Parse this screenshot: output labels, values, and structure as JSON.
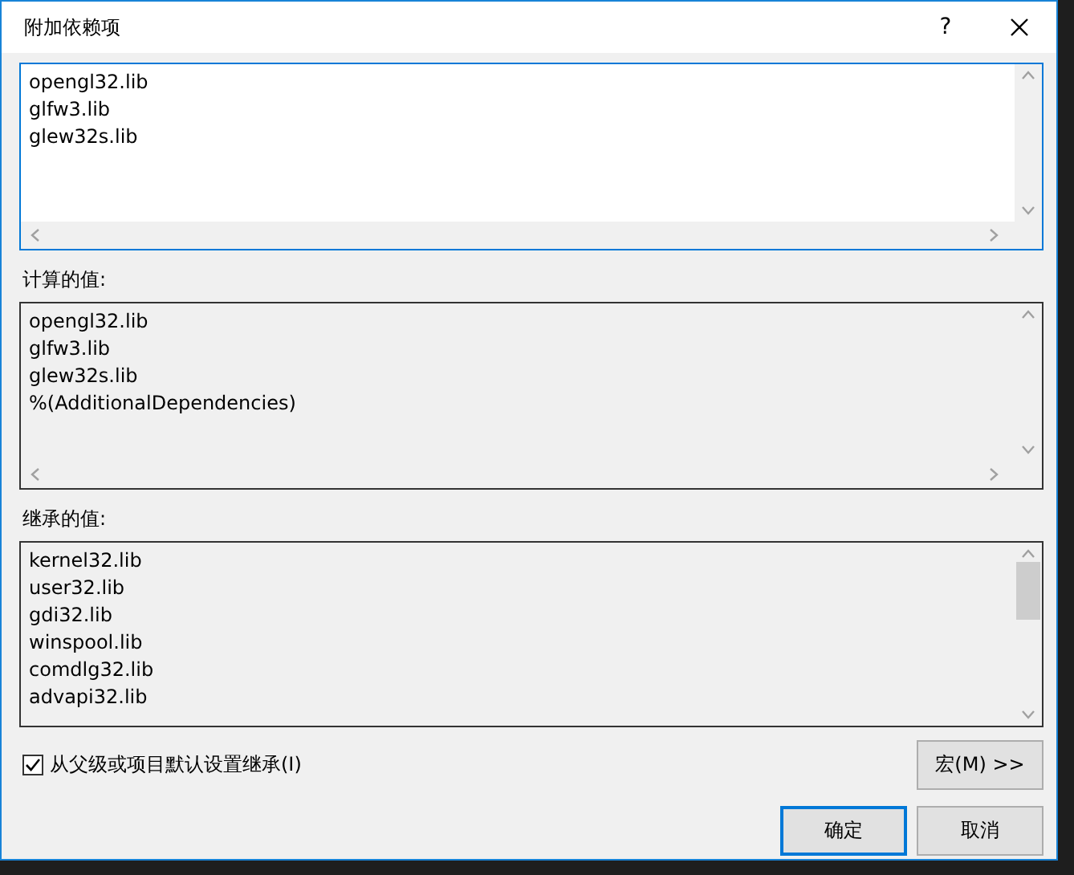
{
  "window": {
    "title": "附加依赖项",
    "help": "?"
  },
  "editor": {
    "lines": [
      "opengl32.lib",
      "glfw3.lib",
      "glew32s.lib"
    ]
  },
  "computed": {
    "label": "计算的值:",
    "lines": [
      "opengl32.lib",
      "glfw3.lib",
      "glew32s.lib",
      "%(AdditionalDependencies)"
    ]
  },
  "inherited": {
    "label": "继承的值:",
    "lines": [
      "kernel32.lib",
      "user32.lib",
      "gdi32.lib",
      "winspool.lib",
      "comdlg32.lib",
      "advapi32.lib"
    ]
  },
  "inherit_checkbox": {
    "label": "从父级或项目默认设置继承(I)",
    "checked": true
  },
  "buttons": [
    {
      "label": "宏(M) >>",
      "kind": "macro"
    },
    {
      "label": "确定",
      "kind": "default"
    },
    {
      "label": "取消",
      "kind": "normal"
    }
  ]
}
